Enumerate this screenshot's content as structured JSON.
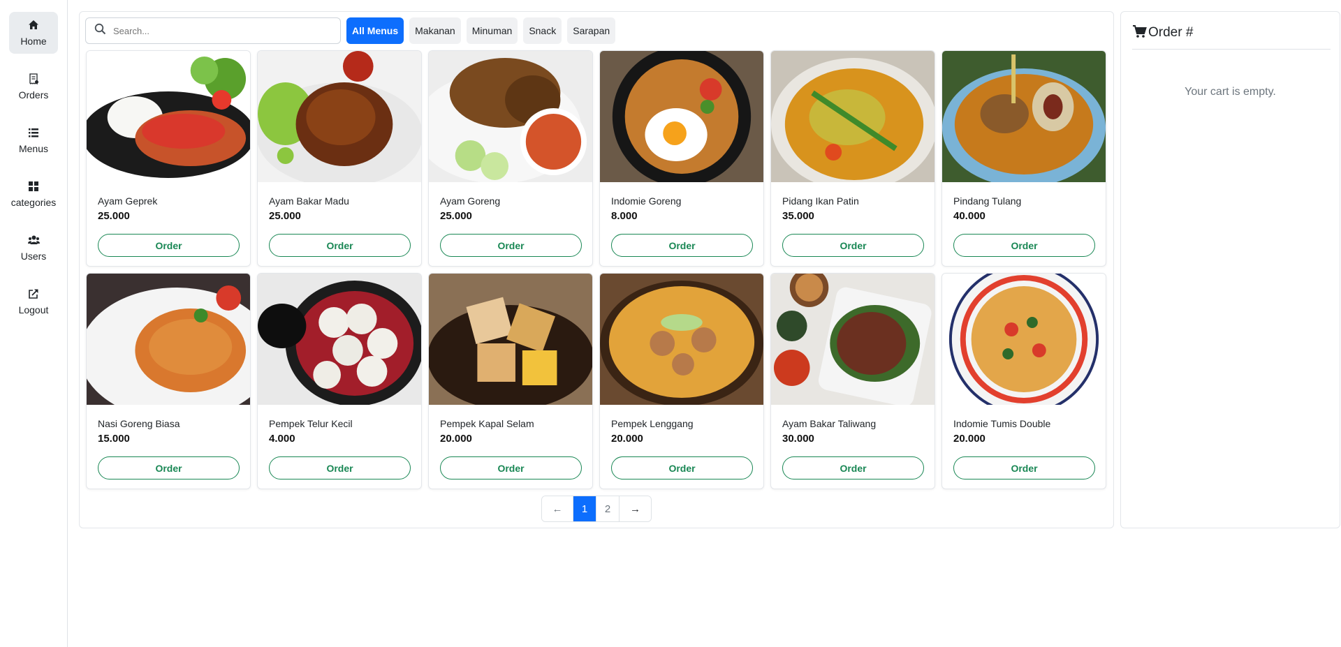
{
  "sidebar": {
    "items": [
      {
        "label": "Home",
        "icon": "home-icon",
        "active": true
      },
      {
        "label": "Orders",
        "icon": "receipt-icon",
        "active": false
      },
      {
        "label": "Menus",
        "icon": "list-icon",
        "active": false
      },
      {
        "label": "categories",
        "icon": "grid-icon",
        "active": false
      },
      {
        "label": "Users",
        "icon": "users-icon",
        "active": false
      },
      {
        "label": "Logout",
        "icon": "logout-icon",
        "active": false
      }
    ]
  },
  "search": {
    "placeholder": "Search...",
    "value": ""
  },
  "filters": [
    {
      "label": "All Menus",
      "active": true
    },
    {
      "label": "Makanan",
      "active": false
    },
    {
      "label": "Minuman",
      "active": false
    },
    {
      "label": "Snack",
      "active": false
    },
    {
      "label": "Sarapan",
      "active": false
    }
  ],
  "menu_items": [
    {
      "name": "Ayam Geprek",
      "price": "25.000",
      "button": "Order"
    },
    {
      "name": "Ayam Bakar Madu",
      "price": "25.000",
      "button": "Order"
    },
    {
      "name": "Ayam Goreng",
      "price": "25.000",
      "button": "Order"
    },
    {
      "name": "Indomie Goreng",
      "price": "8.000",
      "button": "Order"
    },
    {
      "name": "Pidang Ikan Patin",
      "price": "35.000",
      "button": "Order"
    },
    {
      "name": "Pindang Tulang",
      "price": "40.000",
      "button": "Order"
    },
    {
      "name": "Nasi Goreng Biasa",
      "price": "15.000",
      "button": "Order"
    },
    {
      "name": "Pempek Telur Kecil",
      "price": "4.000",
      "button": "Order"
    },
    {
      "name": "Pempek Kapal Selam",
      "price": "20.000",
      "button": "Order"
    },
    {
      "name": "Pempek Lenggang",
      "price": "20.000",
      "button": "Order"
    },
    {
      "name": "Ayam Bakar Taliwang",
      "price": "30.000",
      "button": "Order"
    },
    {
      "name": "Indomie Tumis Double",
      "price": "20.000",
      "button": "Order"
    }
  ],
  "pagination": {
    "prev": "←",
    "pages": [
      "1",
      "2"
    ],
    "current": "1",
    "next": "→"
  },
  "cart": {
    "title": "Order #",
    "empty_text": "Your cart is empty.",
    "icon": "cart-icon"
  },
  "colors": {
    "primary": "#0d6efd",
    "success": "#198754",
    "active_nav": "#e9ecef"
  }
}
